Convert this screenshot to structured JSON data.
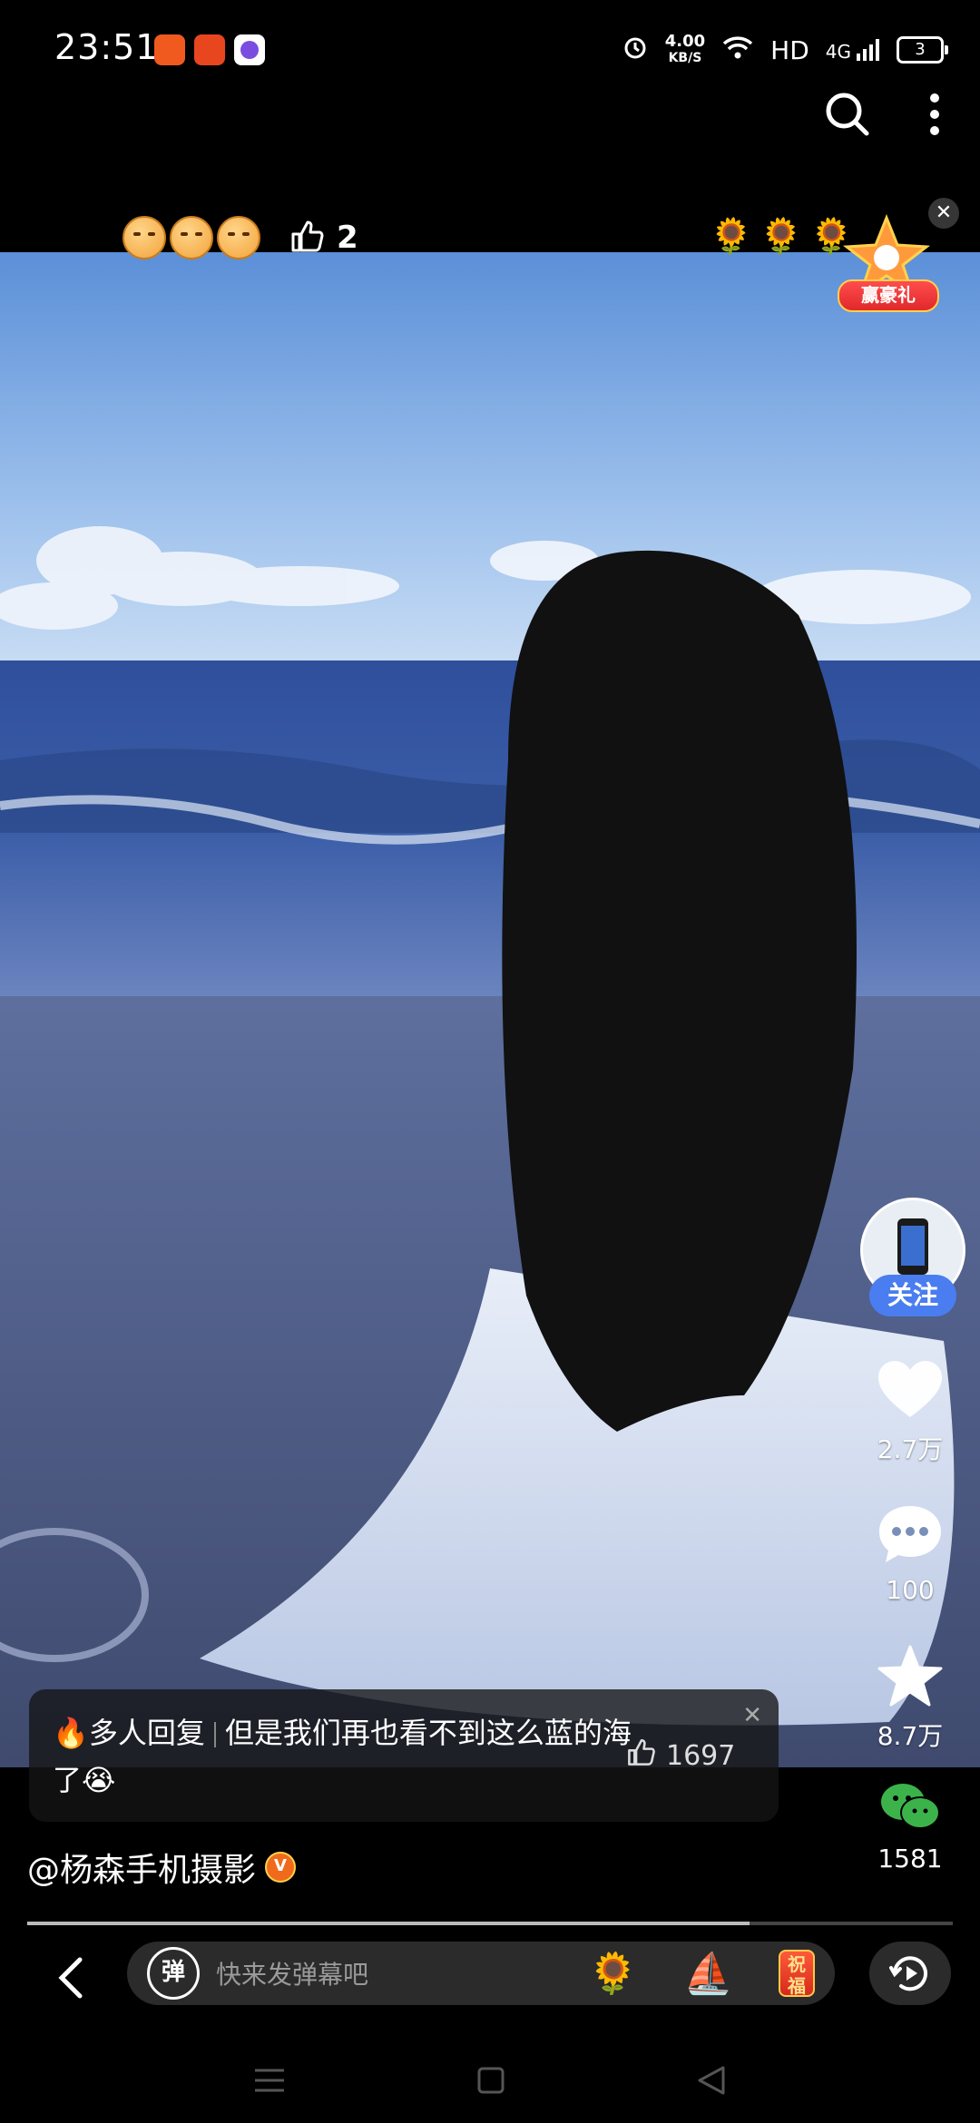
{
  "status_bar": {
    "time": "23:51",
    "net_speed_value": "4.00",
    "net_speed_unit": "KB/S",
    "network_label": "HD",
    "cell_label": "4G",
    "battery_level": "3",
    "app_icons": [
      "app-icon-orange",
      "app-icon-red-orange",
      "app-icon-purple"
    ]
  },
  "header": {
    "search_icon": "search-icon",
    "more_icon": "more-vertical-icon"
  },
  "reactions": {
    "like_count": "2",
    "emoji_names": [
      "smirk-face-emoji",
      "smirk-face-emoji",
      "smirk-face-emoji"
    ],
    "sunflowers": [
      "🌻",
      "🌻",
      "🌻"
    ],
    "gift_label": "赢豪礼"
  },
  "right_rail": {
    "follow_label": "关注",
    "likes": "2.7万",
    "comments": "100",
    "favorites": "8.7万",
    "shares": "1581"
  },
  "comment": {
    "tag": "多人回复",
    "text": "但是我们再也看不到这么蓝的海了😭",
    "like_count": "1697"
  },
  "video": {
    "author": "@杨森手机摄影",
    "verified_mark": "V",
    "progress": 0.78
  },
  "bottom_bar": {
    "danmu_icon_label": "弹",
    "placeholder": "快来发弹幕吧",
    "emoji_1": "🌻",
    "emoji_2": "⛵",
    "fu_label": "祝福"
  },
  "colors": {
    "accent_blue": "#4a7df0",
    "wechat_green": "#3cb34a",
    "verified_orange": "#f06a1c"
  }
}
